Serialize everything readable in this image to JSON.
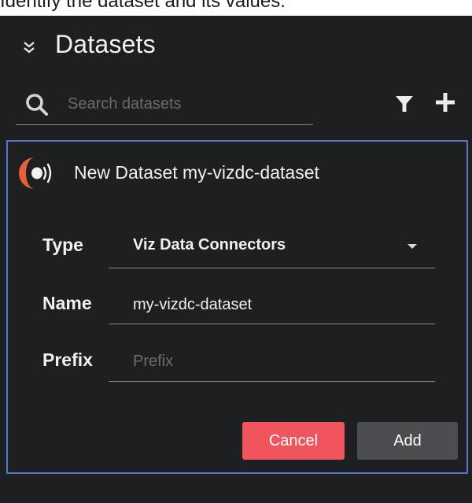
{
  "question": "Identify the dataset and its values.",
  "header": {
    "title": "Datasets"
  },
  "search": {
    "placeholder": "Search datasets"
  },
  "card": {
    "title": "New Dataset my-vizdc-dataset",
    "fields": {
      "type": {
        "label": "Type",
        "value": "Viz Data Connectors"
      },
      "name": {
        "label": "Name",
        "value": "my-vizdc-dataset"
      },
      "prefix": {
        "label": "Prefix",
        "placeholder": "Prefix",
        "value": ""
      }
    },
    "buttons": {
      "cancel": "Cancel",
      "add": "Add"
    }
  },
  "colors": {
    "background": "#1e1f21",
    "accent_border": "#5a73c4",
    "cancel_button": "#f0555e",
    "add_button": "#4b4d51",
    "logo_orange": "#e8603a"
  },
  "icons": {
    "collapse": "chevron-double-down-icon",
    "search": "search-icon",
    "filter": "filter-icon",
    "add": "plus-icon",
    "logo": "dataset-logo"
  }
}
